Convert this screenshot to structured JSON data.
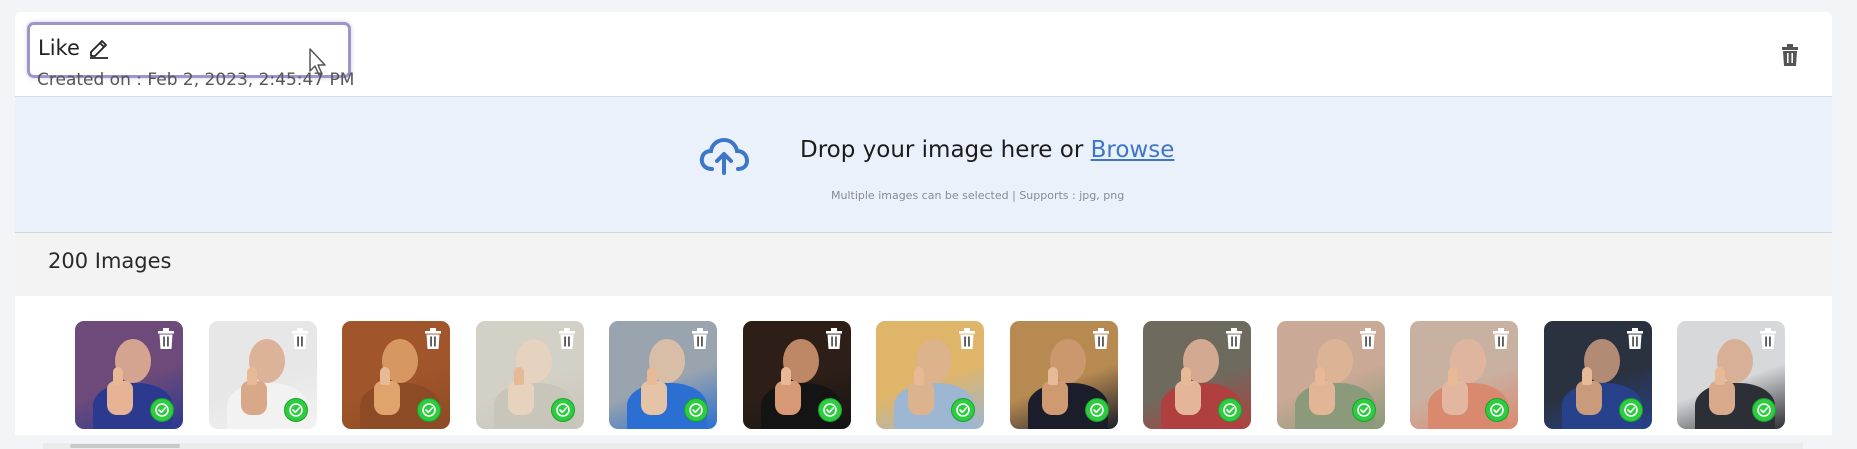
{
  "header": {
    "name_value": "Like",
    "created": "Created on : Feb 2, 2023, 2:45:47 PM"
  },
  "upload": {
    "prompt": "Drop your image here or ",
    "browse_label": "Browse",
    "hint": "Multiple images can be selected | Supports : jpg, png"
  },
  "gallery": {
    "count_label": "200 Images",
    "thumbnails": [
      {
        "bg": "#6d4a7a",
        "skin": "#e6b495",
        "shirt": "#2b3a8f"
      },
      {
        "bg": "#e7e7e7",
        "skin": "#d9a889",
        "shirt": "#f2f2f2"
      },
      {
        "bg": "#a0552a",
        "skin": "#e0a36c",
        "shirt": "#8c4a25"
      },
      {
        "bg": "#d3d0c6",
        "skin": "#e7d2bd",
        "shirt": "#c8c5bb"
      },
      {
        "bg": "#9aa4ae",
        "skin": "#e4c3a6",
        "shirt": "#2a6fd1"
      },
      {
        "bg": "#2e1e18",
        "skin": "#d79a74",
        "shirt": "#141414"
      },
      {
        "bg": "#dfb56a",
        "skin": "#dcb38f",
        "shirt": "#9db7d2"
      },
      {
        "bg": "#b78a52",
        "skin": "#cf9a72",
        "shirt": "#1b1e2a"
      },
      {
        "bg": "#6e6a5e",
        "skin": "#e5b59a",
        "shirt": "#b04040"
      },
      {
        "bg": "#caa996",
        "skin": "#e1b596",
        "shirt": "#8a9a7a"
      },
      {
        "bg": "#c9b1a2",
        "skin": "#e3b6a0",
        "shirt": "#d98a6e"
      },
      {
        "bg": "#2a3240",
        "skin": "#c99b7c",
        "shirt": "#27418a"
      },
      {
        "bg": "#d7d8da",
        "skin": "#d8a98b",
        "shirt": "#2d2f36"
      }
    ]
  },
  "colors": {
    "accent": "#3d76c9",
    "focus_border": "#9e95c9",
    "check": "#2ecc40",
    "drop_bg": "#eaf1fb"
  },
  "icons": {
    "edit": "pencil-icon",
    "delete": "trash-icon",
    "upload": "cloud-upload-icon",
    "status": "check-circle-icon"
  }
}
